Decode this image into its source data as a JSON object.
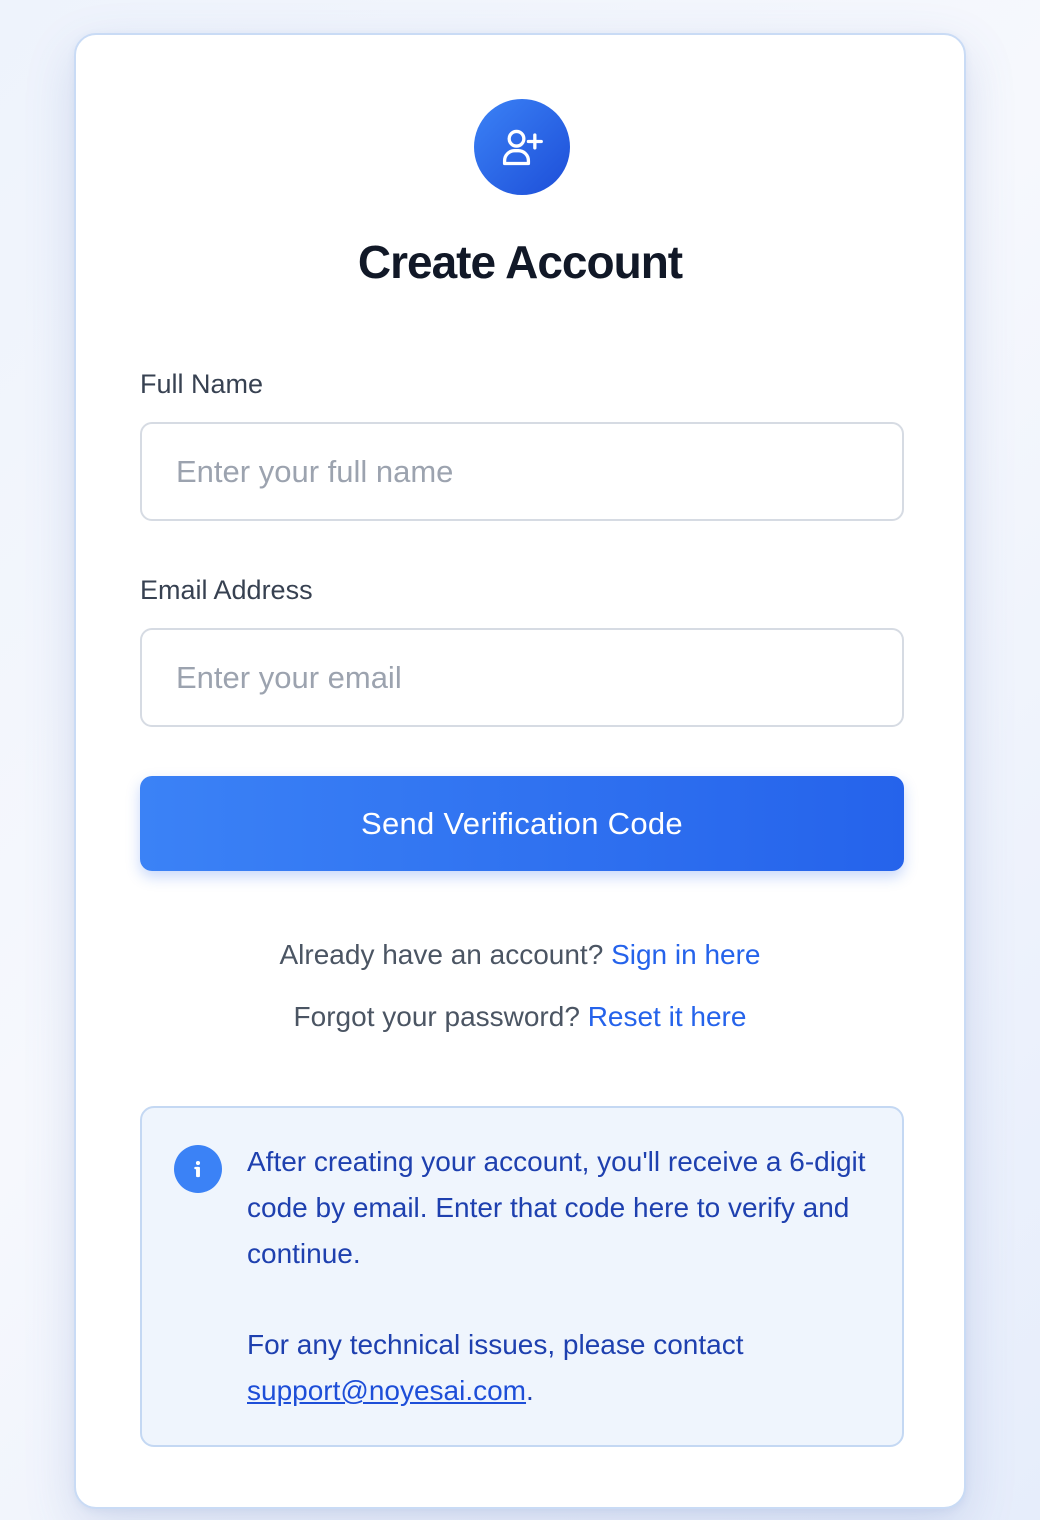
{
  "header": {
    "title": "Create Account",
    "icon": "user-plus-icon"
  },
  "form": {
    "name_label": "Full Name",
    "name_placeholder": "Enter your full name",
    "name_value": "",
    "email_label": "Email Address",
    "email_placeholder": "Enter your email",
    "email_value": "",
    "submit_label": "Send Verification Code"
  },
  "links": {
    "signin_prompt": "Already have an account?",
    "signin_link": "Sign in here",
    "reset_prompt": "Forgot your password?",
    "reset_link": "Reset it here"
  },
  "info": {
    "icon": "info-icon",
    "message": "After creating your account, you'll receive a 6-digit code by email. Enter that code here to verify and continue.",
    "contact_prefix": "For any technical issues, please contact",
    "contact_email": "support@noyesai.com",
    "contact_suffix": "."
  },
  "colors": {
    "accent": "#2563eb",
    "title": "#111827",
    "info_text": "#1e40af",
    "info_background": "#eff5fd"
  }
}
